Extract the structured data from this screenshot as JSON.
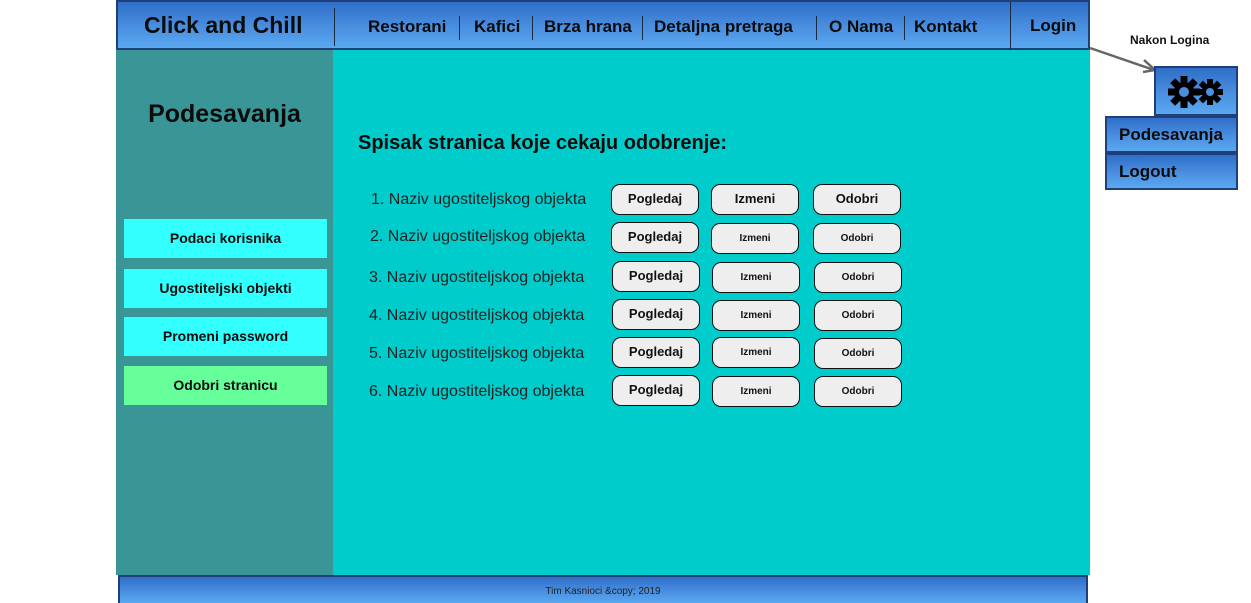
{
  "header": {
    "brand": "Click and Chill",
    "nav": [
      "Restorani",
      "Kafici",
      "Brza hrana",
      "Detaljna pretraga",
      "O Nama",
      "Kontakt"
    ],
    "login": "Login"
  },
  "sidebar": {
    "title": "Podesavanja",
    "items": [
      {
        "label": "Podaci korisnika",
        "active": false
      },
      {
        "label": "Ugostiteljski objekti",
        "active": false
      },
      {
        "label": "Promeni password",
        "active": false
      },
      {
        "label": "Odobri stranicu",
        "active": true
      }
    ]
  },
  "main": {
    "title": "Spisak stranica koje cekaju odobrenje:",
    "rows": [
      {
        "label": "1. Naziv ugostiteljskog objekta",
        "view": "Pogledaj",
        "edit": "Izmeni",
        "approve": "Odobri"
      },
      {
        "label": "2. Naziv ugostiteljskog objekta",
        "view": "Pogledaj",
        "edit": "Izmeni",
        "approve": "Odobri"
      },
      {
        "label": "3. Naziv ugostiteljskog objekta",
        "view": "Pogledaj",
        "edit": "Izmeni",
        "approve": "Odobri"
      },
      {
        "label": "4. Naziv ugostiteljskog objekta",
        "view": "Pogledaj",
        "edit": "Izmeni",
        "approve": "Odobri"
      },
      {
        "label": "5. Naziv ugostiteljskog objekta",
        "view": "Pogledaj",
        "edit": "Izmeni",
        "approve": "Odobri"
      },
      {
        "label": "6. Naziv ugostiteljskog objekta",
        "view": "Pogledaj",
        "edit": "Izmeni",
        "approve": "Odobri"
      }
    ]
  },
  "footer": {
    "text": "Tim Kasnioci &copy; 2019"
  },
  "annotation": {
    "label": "Nakon Logina",
    "icon": "gears-icon",
    "menu": [
      "Podesavanja",
      "Logout"
    ]
  },
  "colors": {
    "header_gradient": "#2f6ec8",
    "sidebar": "#3a9696",
    "main": "#00cccc",
    "side_button": "#33ffff",
    "side_button_active": "#66ff99"
  }
}
